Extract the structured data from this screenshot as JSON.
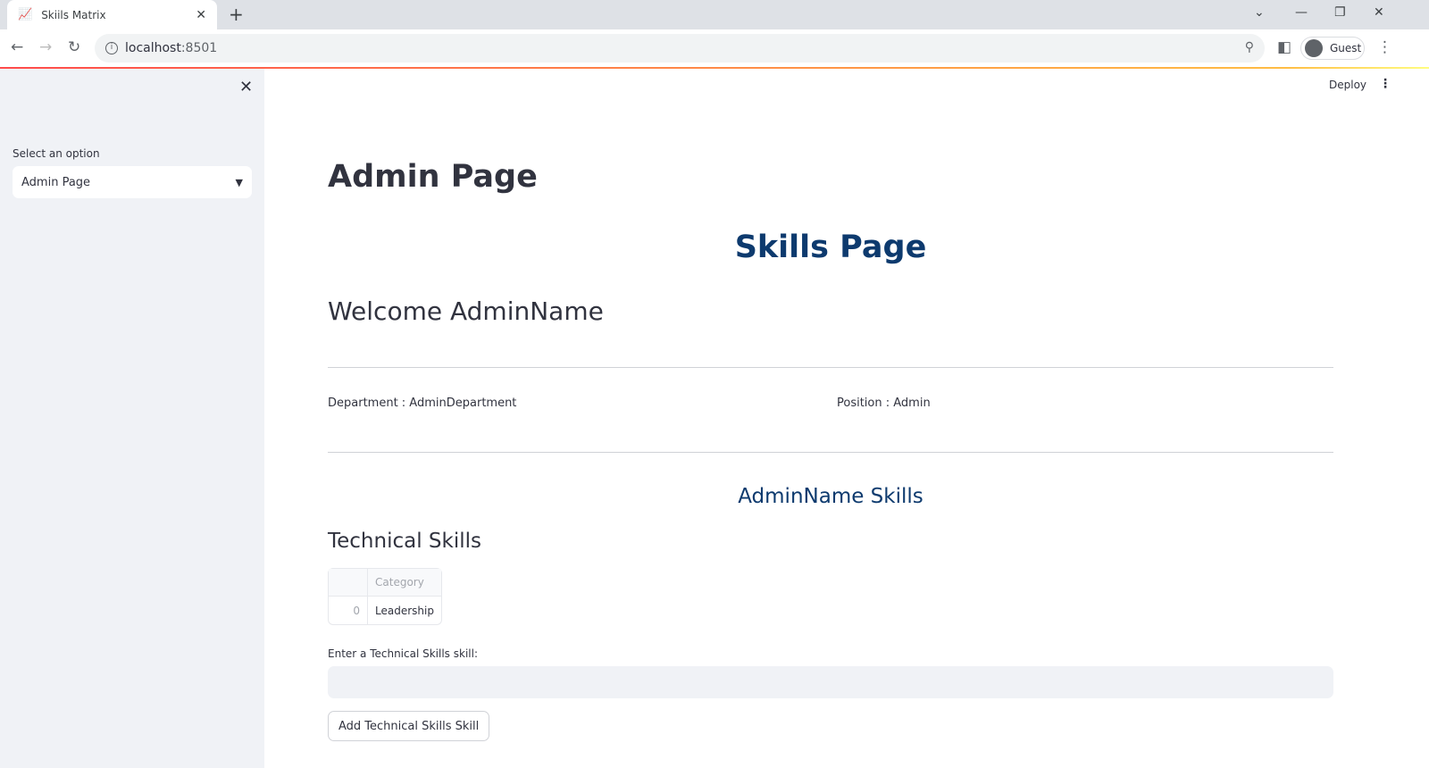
{
  "browser": {
    "tab_title": "Skiils Matrix",
    "url_host": "localhost",
    "url_port": ":8501",
    "profile": "Guest"
  },
  "sidebar": {
    "select_label": "Select an option",
    "select_value": "Admin Page"
  },
  "header": {
    "deploy": "Deploy"
  },
  "main": {
    "title": "Admin Page",
    "subtitle": "Skills Page",
    "welcome": "Welcome AdminName",
    "department": "Department : AdminDepartment",
    "position": "Position : Admin",
    "skills_heading": "AdminName Skills",
    "technical_heading": "Technical Skills",
    "table": {
      "columns": [
        "Category"
      ],
      "rows": [
        {
          "index": "0",
          "category": "Leadership"
        }
      ]
    },
    "input_label": "Enter a Technical Skills skill:",
    "input_value": "",
    "add_button": "Add Technical Skills Skill"
  },
  "accent": "#ff4b4b",
  "heading_color": "#0d3a6e"
}
